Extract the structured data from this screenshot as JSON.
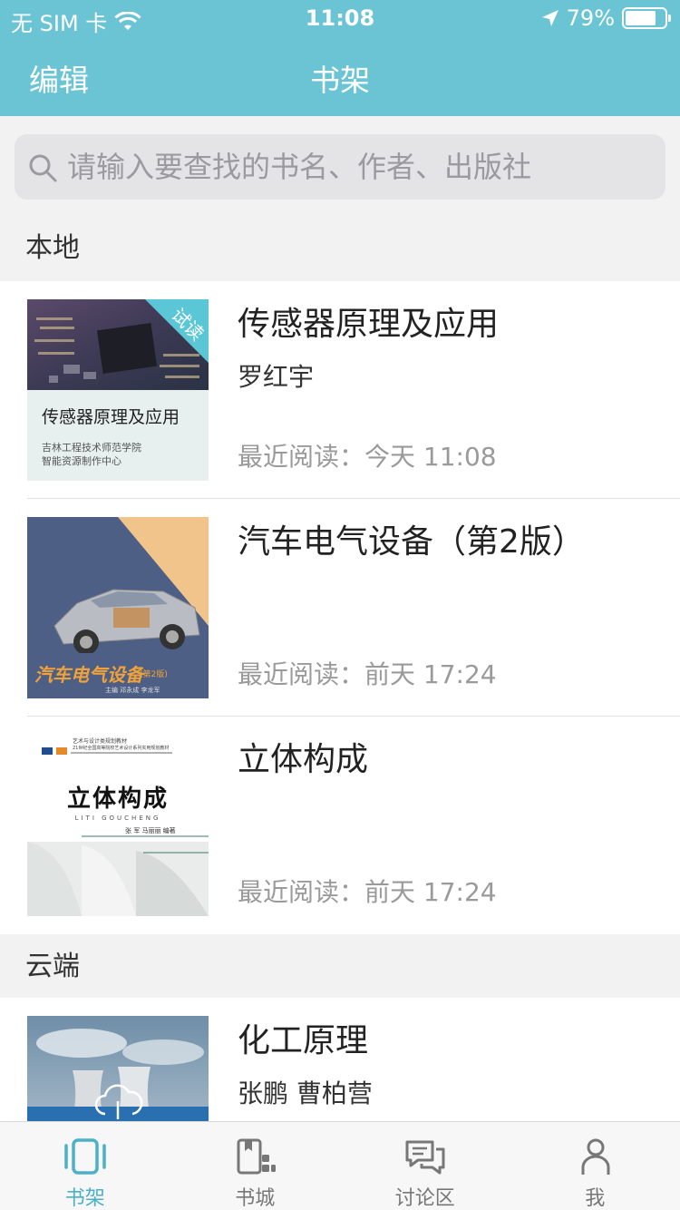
{
  "status_bar": {
    "carrier": "无 SIM 卡",
    "time": "11:08",
    "battery_percent": "79%",
    "battery_level": 0.79
  },
  "nav": {
    "edit_label": "编辑",
    "title": "书架"
  },
  "search": {
    "placeholder": "请输入要查找的书名、作者、出版社"
  },
  "sections": {
    "local": {
      "label": "本地"
    },
    "cloud": {
      "label": "云端"
    }
  },
  "local_books": [
    {
      "title": "传感器原理及应用",
      "author": "罗红宇",
      "recent": "最近阅读：今天 11:08",
      "cover": {
        "badge": "试读",
        "title": "传感器原理及应用",
        "publisher_line1": "吉林工程技术师范学院",
        "publisher_line2": "智能资源制作中心"
      }
    },
    {
      "title": "汽车电气设备（第2版）",
      "author": "",
      "recent": "最近阅读：前天 17:24",
      "cover": {
        "title": "汽车电气设备",
        "edition": "(第2版)",
        "editors": "主编 邓永成 李龙军"
      }
    },
    {
      "title": "立体构成",
      "author": "",
      "recent": "最近阅读：前天 17:24",
      "cover": {
        "series_line1": "艺术与设计类规划教材",
        "series_line2": "21世纪全国高等院校艺术设计系列实用规划教材",
        "title": "立体构成",
        "pinyin": "LITI GOUCHENG",
        "editors": "张 军 马丽丽 编著"
      }
    }
  ],
  "cloud_books": [
    {
      "title": "化工原理",
      "author": "张鹏 曹柏营"
    }
  ],
  "tabbar": {
    "items": [
      {
        "label": "书架",
        "icon": "bookshelf-icon",
        "active": true
      },
      {
        "label": "书城",
        "icon": "bookstore-icon",
        "active": false
      },
      {
        "label": "讨论区",
        "icon": "discussion-icon",
        "active": false
      },
      {
        "label": "我",
        "icon": "profile-icon",
        "active": false
      }
    ]
  },
  "colors": {
    "accent": "#6bc4d4",
    "tab_active": "#4bb0c8",
    "tab_inactive": "#777777",
    "background": "#f2f2f2"
  }
}
